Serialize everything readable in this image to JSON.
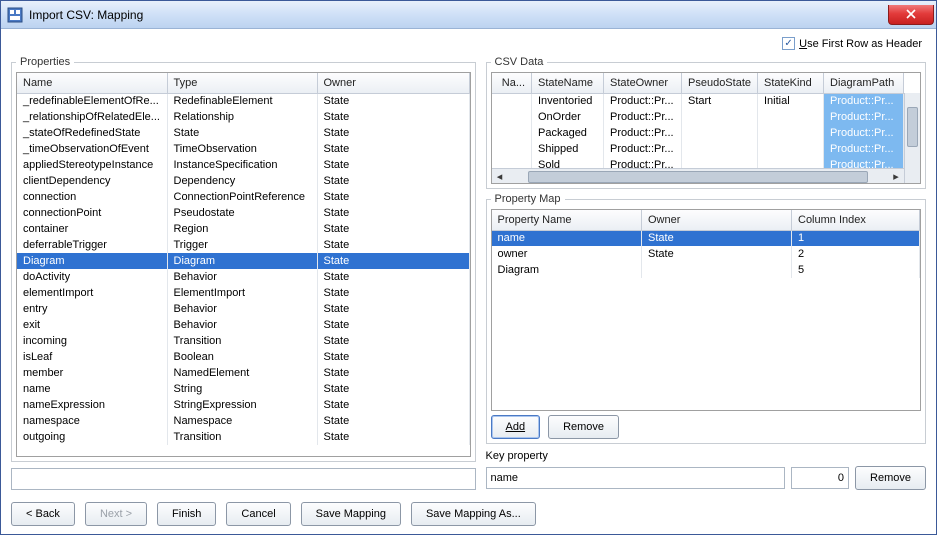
{
  "window": {
    "title": "Import CSV: Mapping"
  },
  "header_checkbox": {
    "label_pre": "",
    "label": "Use First Row as Header",
    "mnemonic_index": 0,
    "checked": true
  },
  "properties": {
    "legend": "Properties",
    "columns": [
      "Name",
      "Type",
      "Owner"
    ],
    "rows": [
      {
        "name": "_redefinableElementOfRe...",
        "type": "RedefinableElement",
        "owner": "State"
      },
      {
        "name": "_relationshipOfRelatedEle...",
        "type": "Relationship",
        "owner": "State"
      },
      {
        "name": "_stateOfRedefinedState",
        "type": "State",
        "owner": "State"
      },
      {
        "name": "_timeObservationOfEvent",
        "type": "TimeObservation",
        "owner": "State"
      },
      {
        "name": "appliedStereotypeInstance",
        "type": "InstanceSpecification",
        "owner": "State"
      },
      {
        "name": "clientDependency",
        "type": "Dependency",
        "owner": "State"
      },
      {
        "name": "connection",
        "type": "ConnectionPointReference",
        "owner": "State"
      },
      {
        "name": "connectionPoint",
        "type": "Pseudostate",
        "owner": "State"
      },
      {
        "name": "container",
        "type": "Region",
        "owner": "State"
      },
      {
        "name": "deferrableTrigger",
        "type": "Trigger",
        "owner": "State"
      },
      {
        "name": "Diagram",
        "type": "Diagram",
        "owner": "State"
      },
      {
        "name": "doActivity",
        "type": "Behavior",
        "owner": "State"
      },
      {
        "name": "elementImport",
        "type": "ElementImport",
        "owner": "State"
      },
      {
        "name": "entry",
        "type": "Behavior",
        "owner": "State"
      },
      {
        "name": "exit",
        "type": "Behavior",
        "owner": "State"
      },
      {
        "name": "incoming",
        "type": "Transition",
        "owner": "State"
      },
      {
        "name": "isLeaf",
        "type": "Boolean",
        "owner": "State"
      },
      {
        "name": "member",
        "type": "NamedElement",
        "owner": "State"
      },
      {
        "name": "name",
        "type": "String",
        "owner": "State"
      },
      {
        "name": "nameExpression",
        "type": "StringExpression",
        "owner": "State"
      },
      {
        "name": "namespace",
        "type": "Namespace",
        "owner": "State"
      },
      {
        "name": "outgoing",
        "type": "Transition",
        "owner": "State"
      }
    ],
    "selected_index": 10,
    "filter_value": ""
  },
  "csv": {
    "legend": "CSV Data",
    "columns": [
      "Na...",
      "StateName",
      "StateOwner",
      "PseudoState",
      "StateKind",
      "DiagramPath"
    ],
    "rows": [
      {
        "c0": "",
        "c1": "Inventoried",
        "c2": "Product::Pr...",
        "c3": "Start",
        "c4": "Initial",
        "c5": "Product::Pr..."
      },
      {
        "c0": "",
        "c1": "OnOrder",
        "c2": "Product::Pr...",
        "c3": "",
        "c4": "",
        "c5": "Product::Pr..."
      },
      {
        "c0": "",
        "c1": "Packaged",
        "c2": "Product::Pr...",
        "c3": "",
        "c4": "",
        "c5": "Product::Pr..."
      },
      {
        "c0": "",
        "c1": "Shipped",
        "c2": "Product::Pr...",
        "c3": "",
        "c4": "",
        "c5": "Product::Pr..."
      },
      {
        "c0": "",
        "c1": "Sold",
        "c2": "Product::Pr...",
        "c3": "",
        "c4": "",
        "c5": "Product::Pr..."
      }
    ]
  },
  "pmap": {
    "legend": "Property Map",
    "columns": [
      "Property Name",
      "Owner",
      "Column Index"
    ],
    "rows": [
      {
        "name": "name",
        "owner": "State",
        "col": "1"
      },
      {
        "name": "owner",
        "owner": "State",
        "col": "2"
      },
      {
        "name": "Diagram",
        "owner": "",
        "col": "5"
      }
    ],
    "selected_index": 0,
    "add_label": "Add",
    "remove_label": "Remove"
  },
  "key": {
    "label": "Key property",
    "value": "name",
    "num": "0",
    "remove_label": "Remove"
  },
  "footer": {
    "back": "< Back",
    "next": "Next >",
    "finish": "Finish",
    "cancel": "Cancel",
    "save": "Save Mapping",
    "save_as": "Save Mapping As..."
  }
}
